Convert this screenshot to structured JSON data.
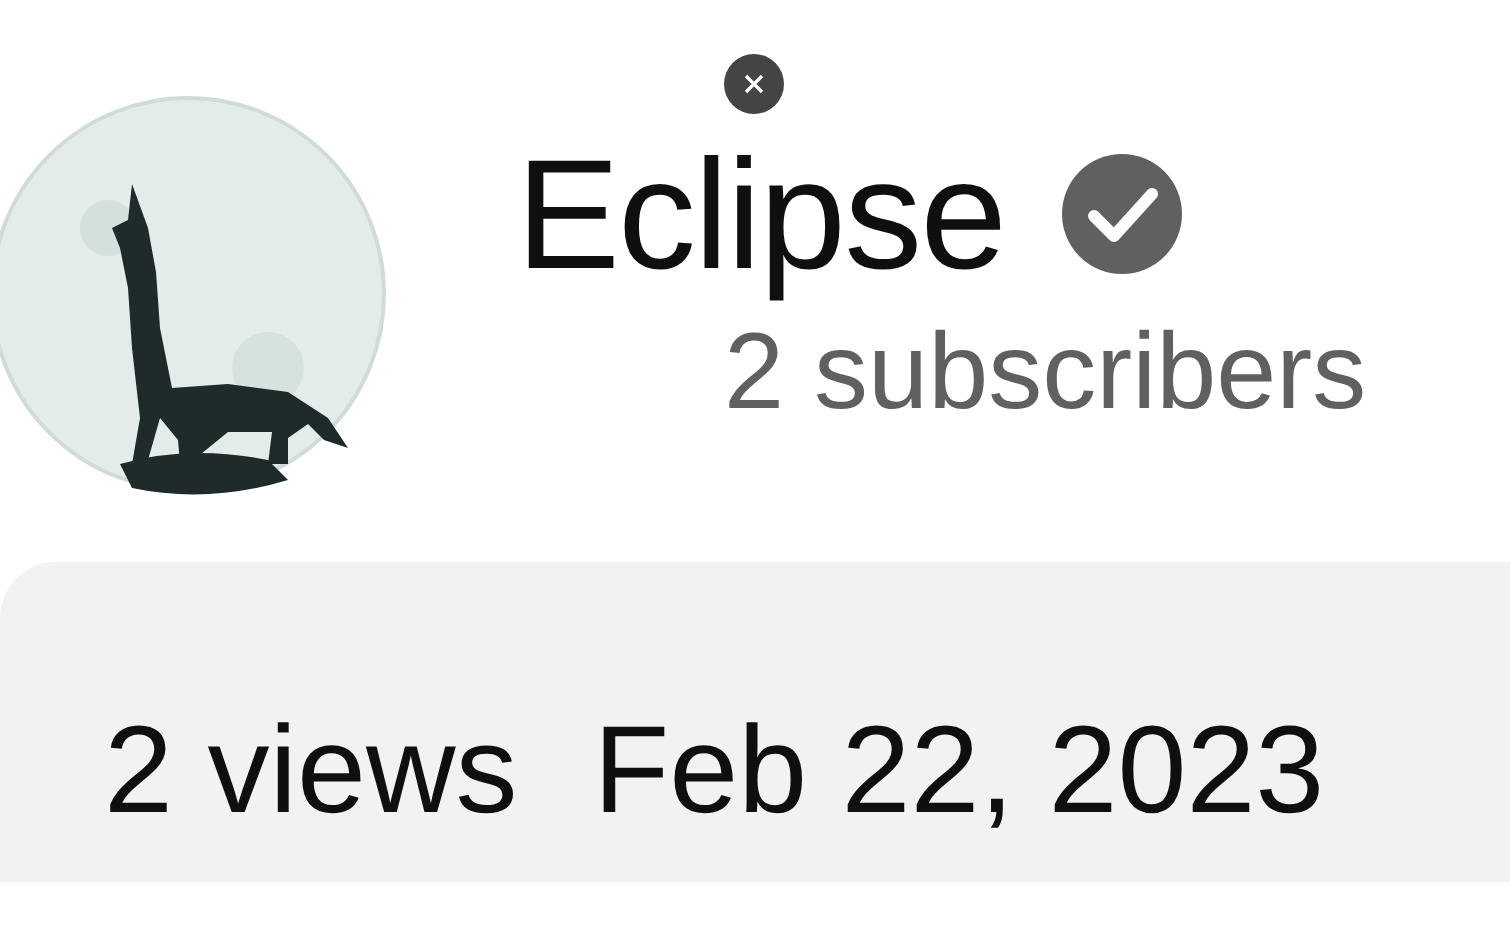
{
  "channel": {
    "name": "Eclipse",
    "verified": true,
    "subscribers": "2 subscribers"
  },
  "description_box": {
    "views": "2 views",
    "date": "Feb 22, 2023"
  }
}
